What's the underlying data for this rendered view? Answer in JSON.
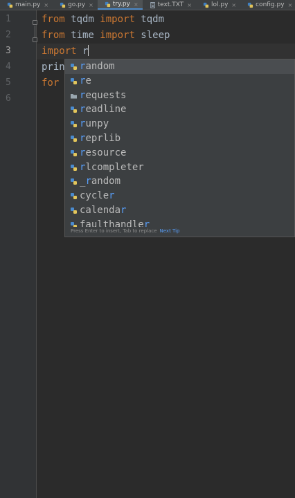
{
  "tabs": [
    {
      "label": "main.py",
      "icon": "python-file-icon",
      "active": false
    },
    {
      "label": "go.py",
      "icon": "python-file-icon",
      "active": false
    },
    {
      "label": "try.py",
      "icon": "python-file-icon",
      "active": true
    },
    {
      "label": "text.TXT",
      "icon": "text-file-icon",
      "active": false
    },
    {
      "label": "lol.py",
      "icon": "python-file-icon",
      "active": false
    },
    {
      "label": "config.py",
      "icon": "python-file-icon",
      "active": false
    }
  ],
  "tab_close_glyph": "×",
  "line_numbers": [
    "1",
    "2",
    "3",
    "4",
    "5",
    "6"
  ],
  "current_line": "3",
  "code": {
    "line1": {
      "kw1": "from",
      "mod": " tqdm ",
      "kw2": "import",
      "name": " tqdm"
    },
    "line2": {
      "kw1": "from",
      "mod": " time ",
      "kw2": "import",
      "name": " sleep"
    },
    "line3": {
      "kw": "import",
      "typed": " r"
    },
    "line4": {
      "text": "prin"
    },
    "line5": {
      "kw": "for"
    }
  },
  "completion": {
    "typed_prefix": "r",
    "items": [
      {
        "hl": "r",
        "rest": "andom",
        "icon": "python-module-icon"
      },
      {
        "hl": "r",
        "rest": "e",
        "icon": "python-module-icon"
      },
      {
        "hl": "r",
        "rest": "equests",
        "icon": "folder-package-icon"
      },
      {
        "hl": "r",
        "rest": "eadline",
        "icon": "python-module-icon"
      },
      {
        "hl": "r",
        "rest": "unpy",
        "icon": "python-module-icon"
      },
      {
        "hl": "r",
        "rest": "eprlib",
        "icon": "python-module-icon"
      },
      {
        "hl": "r",
        "rest": "esource",
        "icon": "python-module-icon"
      },
      {
        "hl": "r",
        "rest": "lcompleter",
        "icon": "python-module-icon"
      },
      {
        "pre": "_",
        "hl": "r",
        "rest": "andom",
        "icon": "python-module-icon"
      },
      {
        "pre": "cycle",
        "hl": "r",
        "rest": "",
        "icon": "python-module-icon"
      },
      {
        "pre": "calenda",
        "hl": "r",
        "rest": "",
        "icon": "python-module-icon"
      },
      {
        "pre": "faulthandle",
        "hl": "r",
        "rest": "",
        "icon": "python-module-icon"
      }
    ],
    "selected_index": 0,
    "hint_text": "Press Enter to insert, Tab to replace",
    "hint_link": "Next Tip"
  },
  "colors": {
    "background": "#2b2b2b",
    "keyword": "#cc7832",
    "identifier": "#a9b7c6",
    "match_highlight": "#589df6",
    "active_tab_underline": "#4a88c7"
  }
}
